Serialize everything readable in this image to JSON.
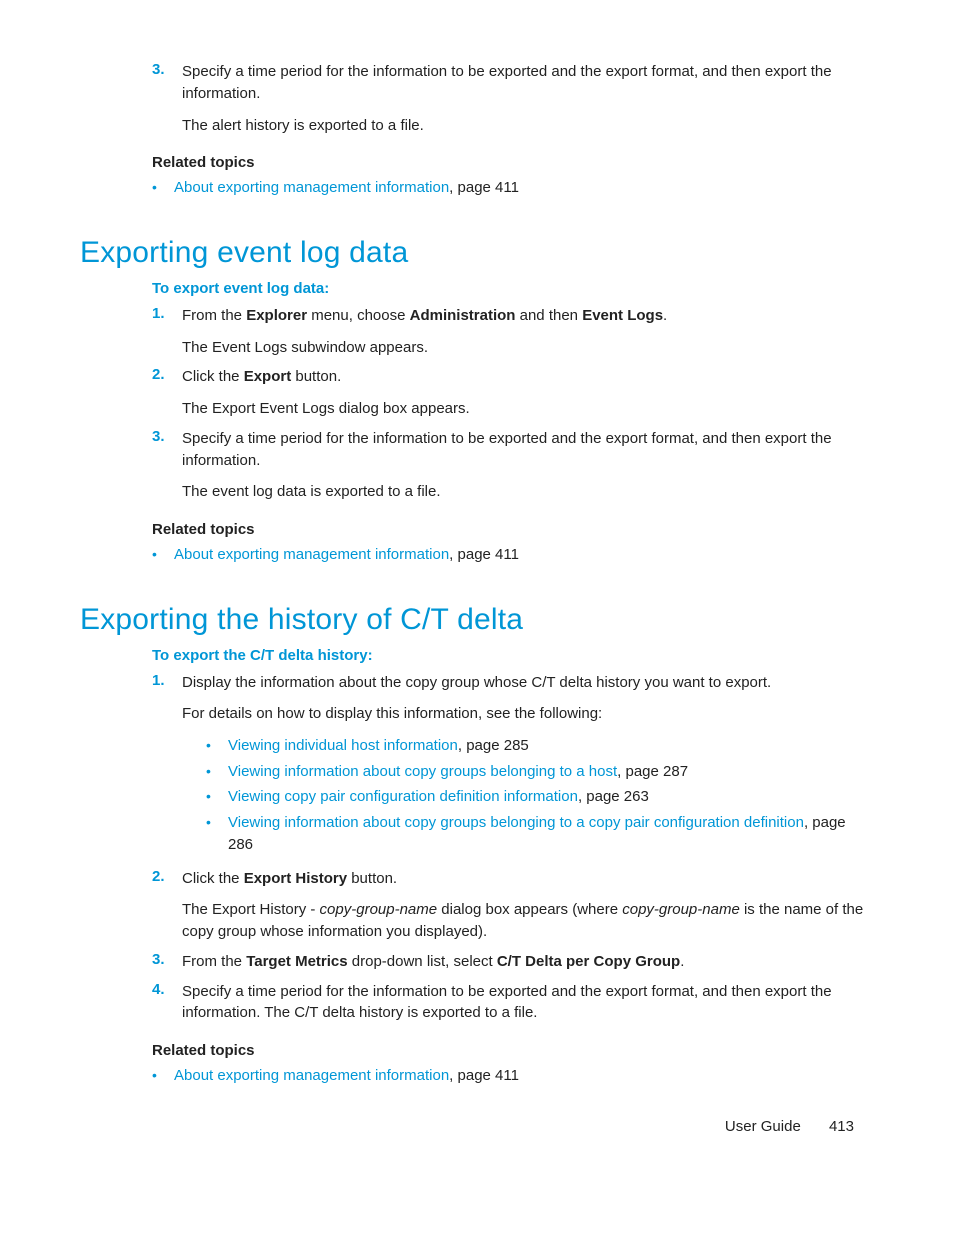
{
  "top": {
    "step3_a": "Specify a time period for the information to be exported and the export format, and then export the information.",
    "step3_b": "The alert history is exported to a file.",
    "related_hdr": "Related topics",
    "rel_link": "About exporting management information",
    "rel_page": ", page 411"
  },
  "sec1": {
    "title": "Exporting event log data",
    "intro": "To export event log data:",
    "s1": {
      "pre": "From the ",
      "b1": "Explorer",
      "mid1": " menu, choose ",
      "b2": "Administration",
      "mid2": " and then ",
      "b3": "Event Logs",
      "post": ".",
      "result": "The Event Logs subwindow appears."
    },
    "s2": {
      "pre": "Click the ",
      "b1": "Export",
      "post": " button.",
      "result": "The Export Event Logs dialog box appears."
    },
    "s3": {
      "a": "Specify a time period for the information to be exported and the export format, and then export the information.",
      "b": "The event log data is exported to a file."
    },
    "related_hdr": "Related topics",
    "rel_link": "About exporting management information",
    "rel_page": ", page 411"
  },
  "sec2": {
    "title": "Exporting the history of C/T delta",
    "intro": "To export the C/T delta history:",
    "s1": {
      "a": "Display the information about the copy group whose C/T delta history you want to export.",
      "b": "For details on how to display this information, see the following:",
      "links": [
        {
          "t": "Viewing individual host information",
          "p": ", page 285"
        },
        {
          "t": "Viewing information about copy groups belonging to a host",
          "p": ", page 287"
        },
        {
          "t": "Viewing copy pair configuration definition information",
          "p": ", page 263"
        },
        {
          "t": "Viewing information about copy groups belonging to a copy pair configuration definition",
          "p": ", page 286"
        }
      ]
    },
    "s2": {
      "pre": "Click the ",
      "b1": "Export History",
      "post": " button.",
      "r_pre": "The Export History - ",
      "r_i1": "copy-group-name",
      "r_mid": " dialog box appears (where ",
      "r_i2": "copy-group-name",
      "r_post": " is the name of the copy group whose information you displayed)."
    },
    "s3": {
      "pre": "From the ",
      "b1": "Target Metrics",
      "mid": " drop-down list, select ",
      "b2": "C/T Delta per Copy Group",
      "post": "."
    },
    "s4": "Specify a time period for the information to be exported and the export format, and then export the information. The C/T delta history is exported to a file.",
    "related_hdr": "Related topics",
    "rel_link": "About exporting management information",
    "rel_page": ", page 411"
  },
  "footer": {
    "label": "User Guide",
    "page": "413"
  },
  "nums": {
    "n1": "1.",
    "n2": "2.",
    "n3": "3.",
    "n4": "4."
  },
  "dot": "•"
}
